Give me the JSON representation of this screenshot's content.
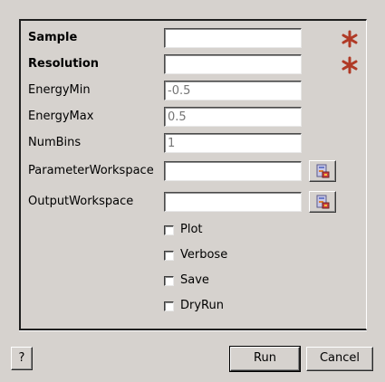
{
  "form": {
    "fields": [
      {
        "label": "Sample",
        "value": "",
        "required": true
      },
      {
        "label": "Resolution",
        "value": "",
        "required": true
      },
      {
        "label": "EnergyMin",
        "placeholder": "-0.5"
      },
      {
        "label": "EnergyMax",
        "placeholder": "0.5"
      },
      {
        "label": "NumBins",
        "placeholder": "1"
      },
      {
        "label": "ParameterWorkspace",
        "value": ""
      },
      {
        "label": "OutputWorkspace",
        "value": ""
      }
    ],
    "checkboxes": [
      {
        "label": "Plot",
        "checked": false
      },
      {
        "label": "Verbose",
        "checked": false
      },
      {
        "label": "Save",
        "checked": false
      },
      {
        "label": "DryRun",
        "checked": false
      }
    ]
  },
  "buttons": {
    "help": "?",
    "run": "Run",
    "cancel": "Cancel"
  },
  "icons": {
    "required": "asterisk-icon",
    "browse": "workspace-icon"
  },
  "colors": {
    "background": "#d6d2ce",
    "required_marker": "#b03a26",
    "placeholder_text": "#8e8e8e"
  }
}
